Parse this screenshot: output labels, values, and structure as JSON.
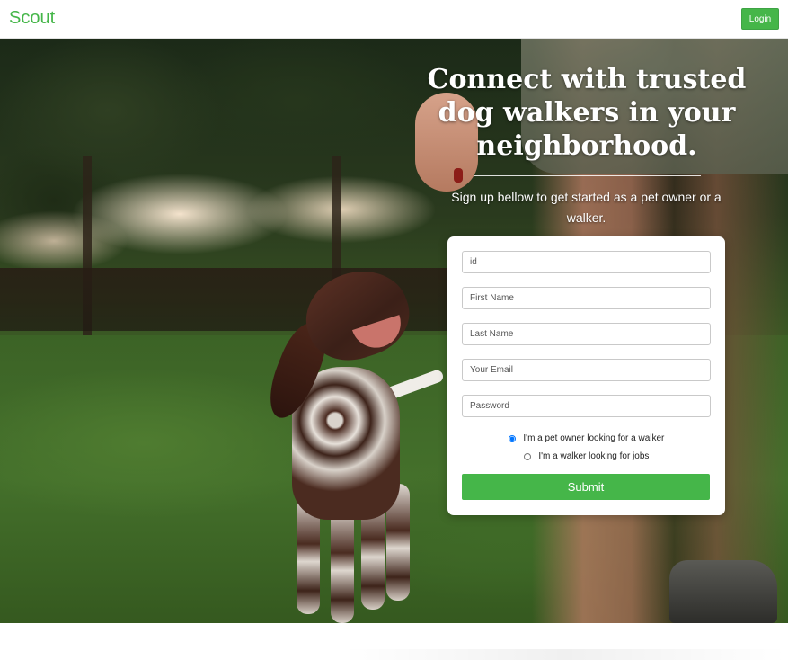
{
  "navbar": {
    "brand": "Scout",
    "login_label": "Login"
  },
  "hero": {
    "title": "Connect with trusted dog walkers in your neighborhood.",
    "subtitle": "Sign up bellow to get started as a pet owner or a walker."
  },
  "form": {
    "fields": [
      {
        "name": "id",
        "placeholder": "id",
        "value": ""
      },
      {
        "name": "first_name",
        "placeholder": "First Name",
        "value": ""
      },
      {
        "name": "last_name",
        "placeholder": "Last Name",
        "value": ""
      },
      {
        "name": "email",
        "placeholder": "Your Email",
        "value": ""
      },
      {
        "name": "password",
        "placeholder": "Password",
        "value": ""
      }
    ],
    "role_options": [
      {
        "label": "I'm a pet owner looking for a walker",
        "selected": true
      },
      {
        "label": "I'm a walker looking for jobs",
        "selected": false
      }
    ],
    "submit_label": "Submit"
  },
  "colors": {
    "brand_green": "#45b649",
    "card_background": "#ffffff",
    "hero_text": "#ffffff"
  },
  "icons": {
    "radio_selected": "radio-filled-icon",
    "radio_unselected": "radio-empty-icon"
  }
}
